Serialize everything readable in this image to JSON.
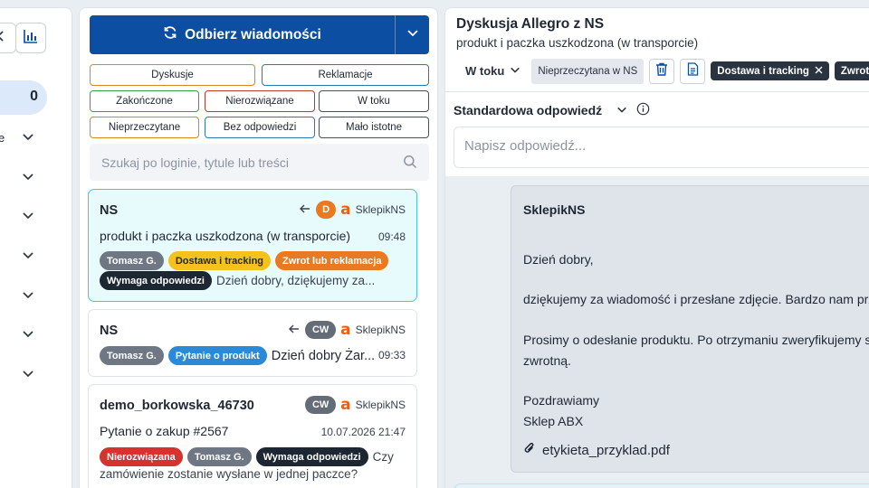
{
  "sidebar": {
    "count": "0",
    "partial_label": "e",
    "icons": [
      "chevron-left-icon",
      "bar-chart-icon"
    ]
  },
  "inbox": {
    "receive_label": "Odbierz wiadomości",
    "filters": {
      "row1": [
        "Dyskusje",
        "Reklamacje"
      ],
      "row2": [
        "Zakończone",
        "Nierozwiązane",
        "W toku"
      ],
      "row3": [
        "Nieprzeczytane",
        "Bez odpowiedzi",
        "Mało istotne"
      ]
    },
    "search_placeholder": "Szukaj po loginie, tytule lub treści",
    "cards": [
      {
        "name": "NS",
        "subject": "produkt i paczka uszkodzona (w transporcie)",
        "time": "09:48",
        "badge": "D",
        "shop": "SklepikNS",
        "tags": [
          "Tomasz G.",
          "Dostawa i tracking",
          "Zwrot lub reklamacja"
        ],
        "tags2": [
          "Wymaga odpowiedzi"
        ],
        "preview": "Dzień dobry, dziękujemy za..."
      },
      {
        "name": "NS",
        "badge": "CW",
        "shop": "SklepikNS",
        "tags": [
          "Tomasz G.",
          "Pytanie o produkt"
        ],
        "preview": "Dzień dobry Żar...",
        "time": "09:33"
      },
      {
        "name": "demo_borkowska_46730",
        "badge": "CW",
        "shop": "SklepikNS",
        "subject": "Pytanie o zakup #2567",
        "time": "10.07.2026 21:47",
        "tags": [
          "Nierozwiązana",
          "Tomasz G.",
          "Wymaga odpowiedzi"
        ],
        "preview_start": "Czy",
        "preview_rest": "zamówienie zostanie wysłane w jednej paczce?"
      }
    ]
  },
  "discussion": {
    "title": "Dyskusja Allegro z NS",
    "subtitle": "produkt i paczka uszkodzona (w transporcie)",
    "status": "W toku",
    "unread_label": "Nieprzeczytana w NS",
    "tags": [
      "Dostawa i tracking",
      "Zwrot lub"
    ],
    "std_reply_label": "Standardowa odpowiedź",
    "reply_placeholder": "Napisz odpowiedź...",
    "message": {
      "from": "SklepikNS",
      "lines": [
        "Dzień dobry,",
        "dziękujemy za wiadomość i przesłane zdjęcie. Bardzo nam przy",
        "Prosimy o odesłanie produktu. Po otrzymaniu zweryfikujemy s",
        "zwrotną.",
        "Pozdrawiamy",
        "Sklep ABX"
      ],
      "attachment": "etykieta_przyklad.pdf"
    }
  },
  "colors": {
    "primary": "#0b4ea2",
    "active_card": "#e8fbfc",
    "allegro": "#ff5a00"
  }
}
